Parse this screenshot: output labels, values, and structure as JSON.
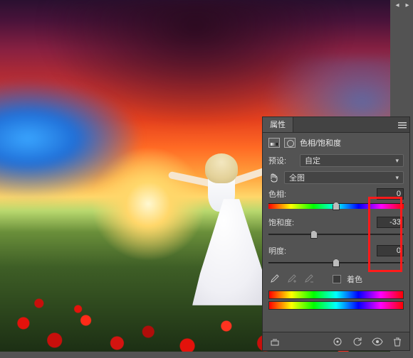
{
  "panel": {
    "title_tab": "属性",
    "adjustment_name": "色相/饱和度",
    "preset_label": "预设:",
    "preset_value": "自定",
    "channel_value": "全图",
    "hue_label": "色相:",
    "saturation_label": "饱和度:",
    "lightness_label": "明度:",
    "hue_value": "0",
    "saturation_value": "-33",
    "lightness_value": "0",
    "colorize_label": "着色"
  },
  "sliders": {
    "hue_percent": 50,
    "saturation_percent": 33.5,
    "lightness_percent": 50
  },
  "icons": {
    "panel_menu": "panel-menu-icon",
    "hand": "target-adjust-icon",
    "eyedropper": "eyedropper-icon",
    "eyedropper_plus": "eyedropper-plus-icon",
    "eyedropper_minus": "eyedropper-minus-icon",
    "clip": "clip-to-layer-icon",
    "prev_state": "view-previous-icon",
    "reset": "reset-icon",
    "visibility": "visibility-icon",
    "trash": "trash-icon"
  }
}
